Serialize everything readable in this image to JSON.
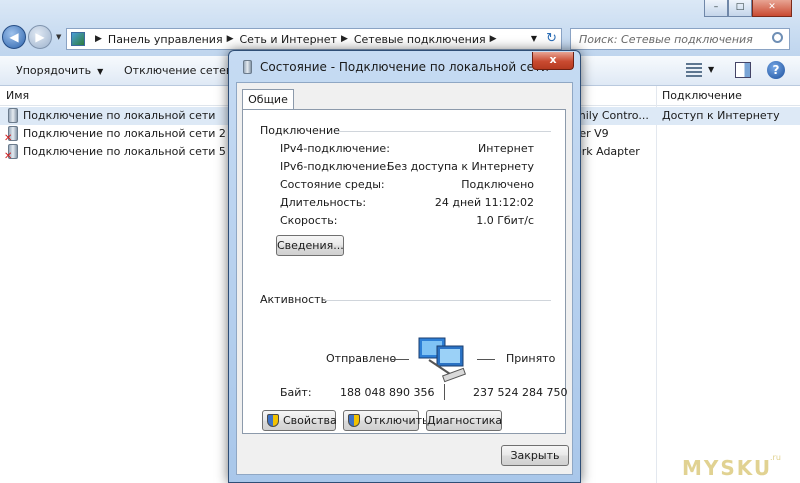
{
  "explorer": {
    "address_crumbs": [
      "Панель управления",
      "Сеть и Интернет",
      "Сетевые подключения"
    ],
    "search_placeholder": "Поиск: Сетевые подключения",
    "toolbar": {
      "organize": "Упорядочить",
      "disable": "Отключение сетевого устройства"
    },
    "columns": {
      "name": "Имя",
      "connectivity": "Подключение"
    },
    "rows": [
      {
        "name": "Подключение по локальной сети",
        "device": "mily Contro...",
        "connectivity": "Доступ к Интернету",
        "disabled": false,
        "selected": true
      },
      {
        "name": "Подключение по локальной сети 2",
        "device": "ter V9",
        "connectivity": "",
        "disabled": true,
        "selected": false
      },
      {
        "name": "Подключение по локальной сети 5",
        "device": "ork Adapter",
        "connectivity": "",
        "disabled": true,
        "selected": false
      }
    ]
  },
  "watermark": {
    "text": "MYSKU",
    "suffix": ".ru"
  },
  "dialog": {
    "title": "Состояние - Подключение по локальной сети",
    "close_label": "x",
    "tab_general": "Общие",
    "connection": {
      "heading": "Подключение",
      "ipv4_label": "IPv4-подключение:",
      "ipv4_value": "Интернет",
      "ipv6_label": "IPv6-подключение:",
      "ipv6_value": "Без доступа к Интернету",
      "media_label": "Состояние среды:",
      "media_value": "Подключено",
      "duration_label": "Длительность:",
      "duration_value": "24 дней 11:12:02",
      "speed_label": "Скорость:",
      "speed_value": "1.0 Гбит/с",
      "details_button": "Сведения..."
    },
    "activity": {
      "heading": "Активность",
      "sent_label": "Отправлено",
      "received_label": "Принято",
      "bytes_label": "Байт:",
      "bytes_sent": "188 048 890 356",
      "bytes_received": "237 524 284 750"
    },
    "buttons": {
      "properties": "Свойства",
      "disable": "Отключить",
      "diagnose": "Диагностика",
      "close": "Закрыть"
    }
  }
}
